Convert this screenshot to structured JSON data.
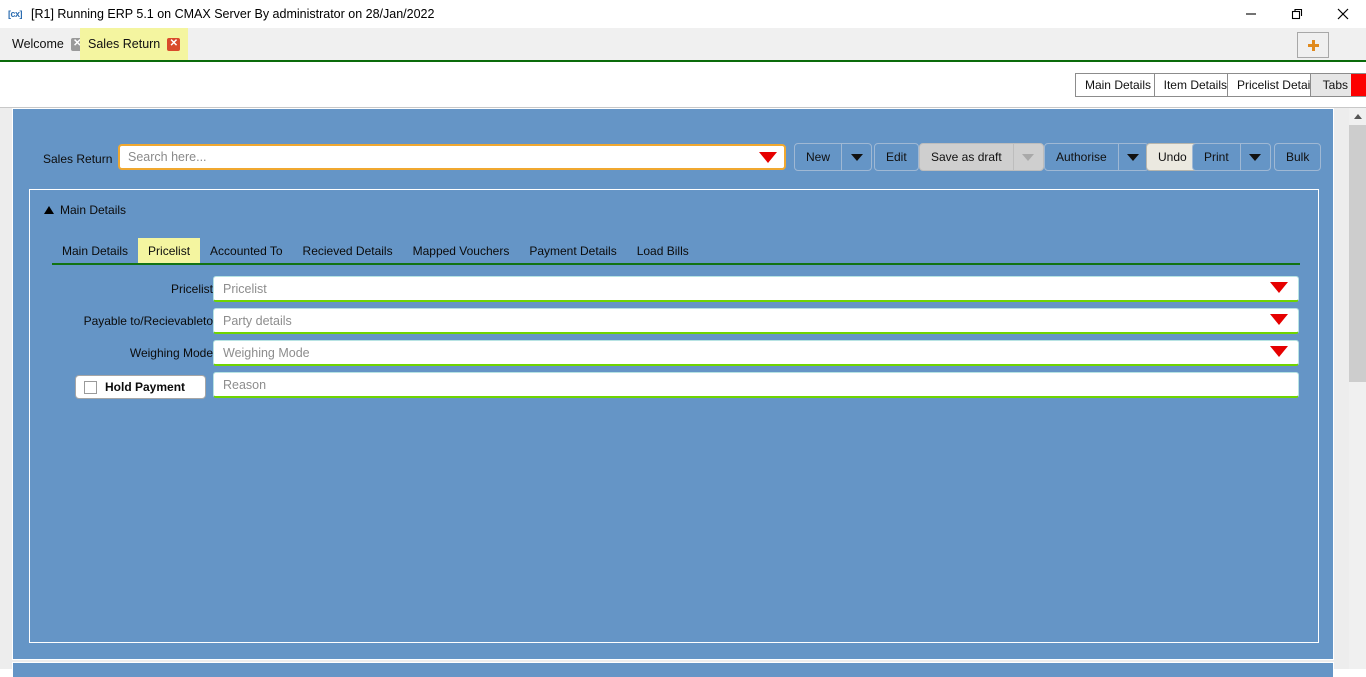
{
  "window": {
    "title": "[R1] Running ERP 5.1 on CMAX Server By administrator on 28/Jan/2022",
    "app_icon": "cx-app-icon",
    "controls": {
      "minimize": "minimize-icon",
      "maximize": "maximize-icon",
      "close": "close-icon"
    }
  },
  "tabstrip": {
    "tabs": [
      {
        "label": "Welcome",
        "active": false,
        "close": "✕"
      },
      {
        "label": "Sales Return",
        "active": true,
        "close": "✕"
      }
    ],
    "new_tab_label": "+",
    "accent_green": "#0a6b0a",
    "active_tab_bg": "#f4f5a0"
  },
  "ribbon": {
    "buttons": [
      {
        "label": "Main Details"
      },
      {
        "label": "Item Details"
      },
      {
        "label": "Pricelist Details"
      },
      {
        "label": "Tabs"
      }
    ],
    "tabs_marker_color": "#fc0000"
  },
  "toolbar": {
    "module_label": "Sales Return",
    "search": {
      "placeholder": "Search here...",
      "value": "",
      "border_color": "#f0a830",
      "caret": "dropdown-caret-icon"
    },
    "actions": {
      "new": "New",
      "edit": "Edit",
      "save_as_draft": "Save as draft",
      "authorise": "Authorise",
      "undo": "Undo",
      "print": "Print",
      "bulk": "Bulk"
    }
  },
  "details": {
    "section_title": "Main Details",
    "collapse_icon": "triangle-up-icon",
    "inner_tabs": [
      {
        "label": "Main Details",
        "active": false
      },
      {
        "label": "Pricelist",
        "active": true
      },
      {
        "label": "Accounted To",
        "active": false
      },
      {
        "label": "Recieved Details",
        "active": false
      },
      {
        "label": "Mapped Vouchers",
        "active": false
      },
      {
        "label": "Payment Details",
        "active": false
      },
      {
        "label": "Load Bills",
        "active": false
      }
    ],
    "fields": [
      {
        "label": "Pricelist",
        "placeholder": "Pricelist",
        "value": "",
        "has_dropdown": true
      },
      {
        "label": "Payable to/Recievableto",
        "placeholder": "Party details",
        "value": "",
        "has_dropdown": true
      },
      {
        "label": "Weighing Mode",
        "placeholder": "Weighing Mode",
        "value": "",
        "has_dropdown": true
      }
    ],
    "hold_payment": {
      "label": "Hold Payment",
      "checked": false,
      "reason_placeholder": "Reason",
      "reason_value": ""
    },
    "field_underline_color": "#6fd400",
    "tab_underline_color": "#127312"
  },
  "scrollbar": {
    "up_arrow": "scroll-up-icon",
    "position": "top"
  },
  "theme": {
    "panel_blue": "#6595c6",
    "page_grey": "#ededed"
  }
}
